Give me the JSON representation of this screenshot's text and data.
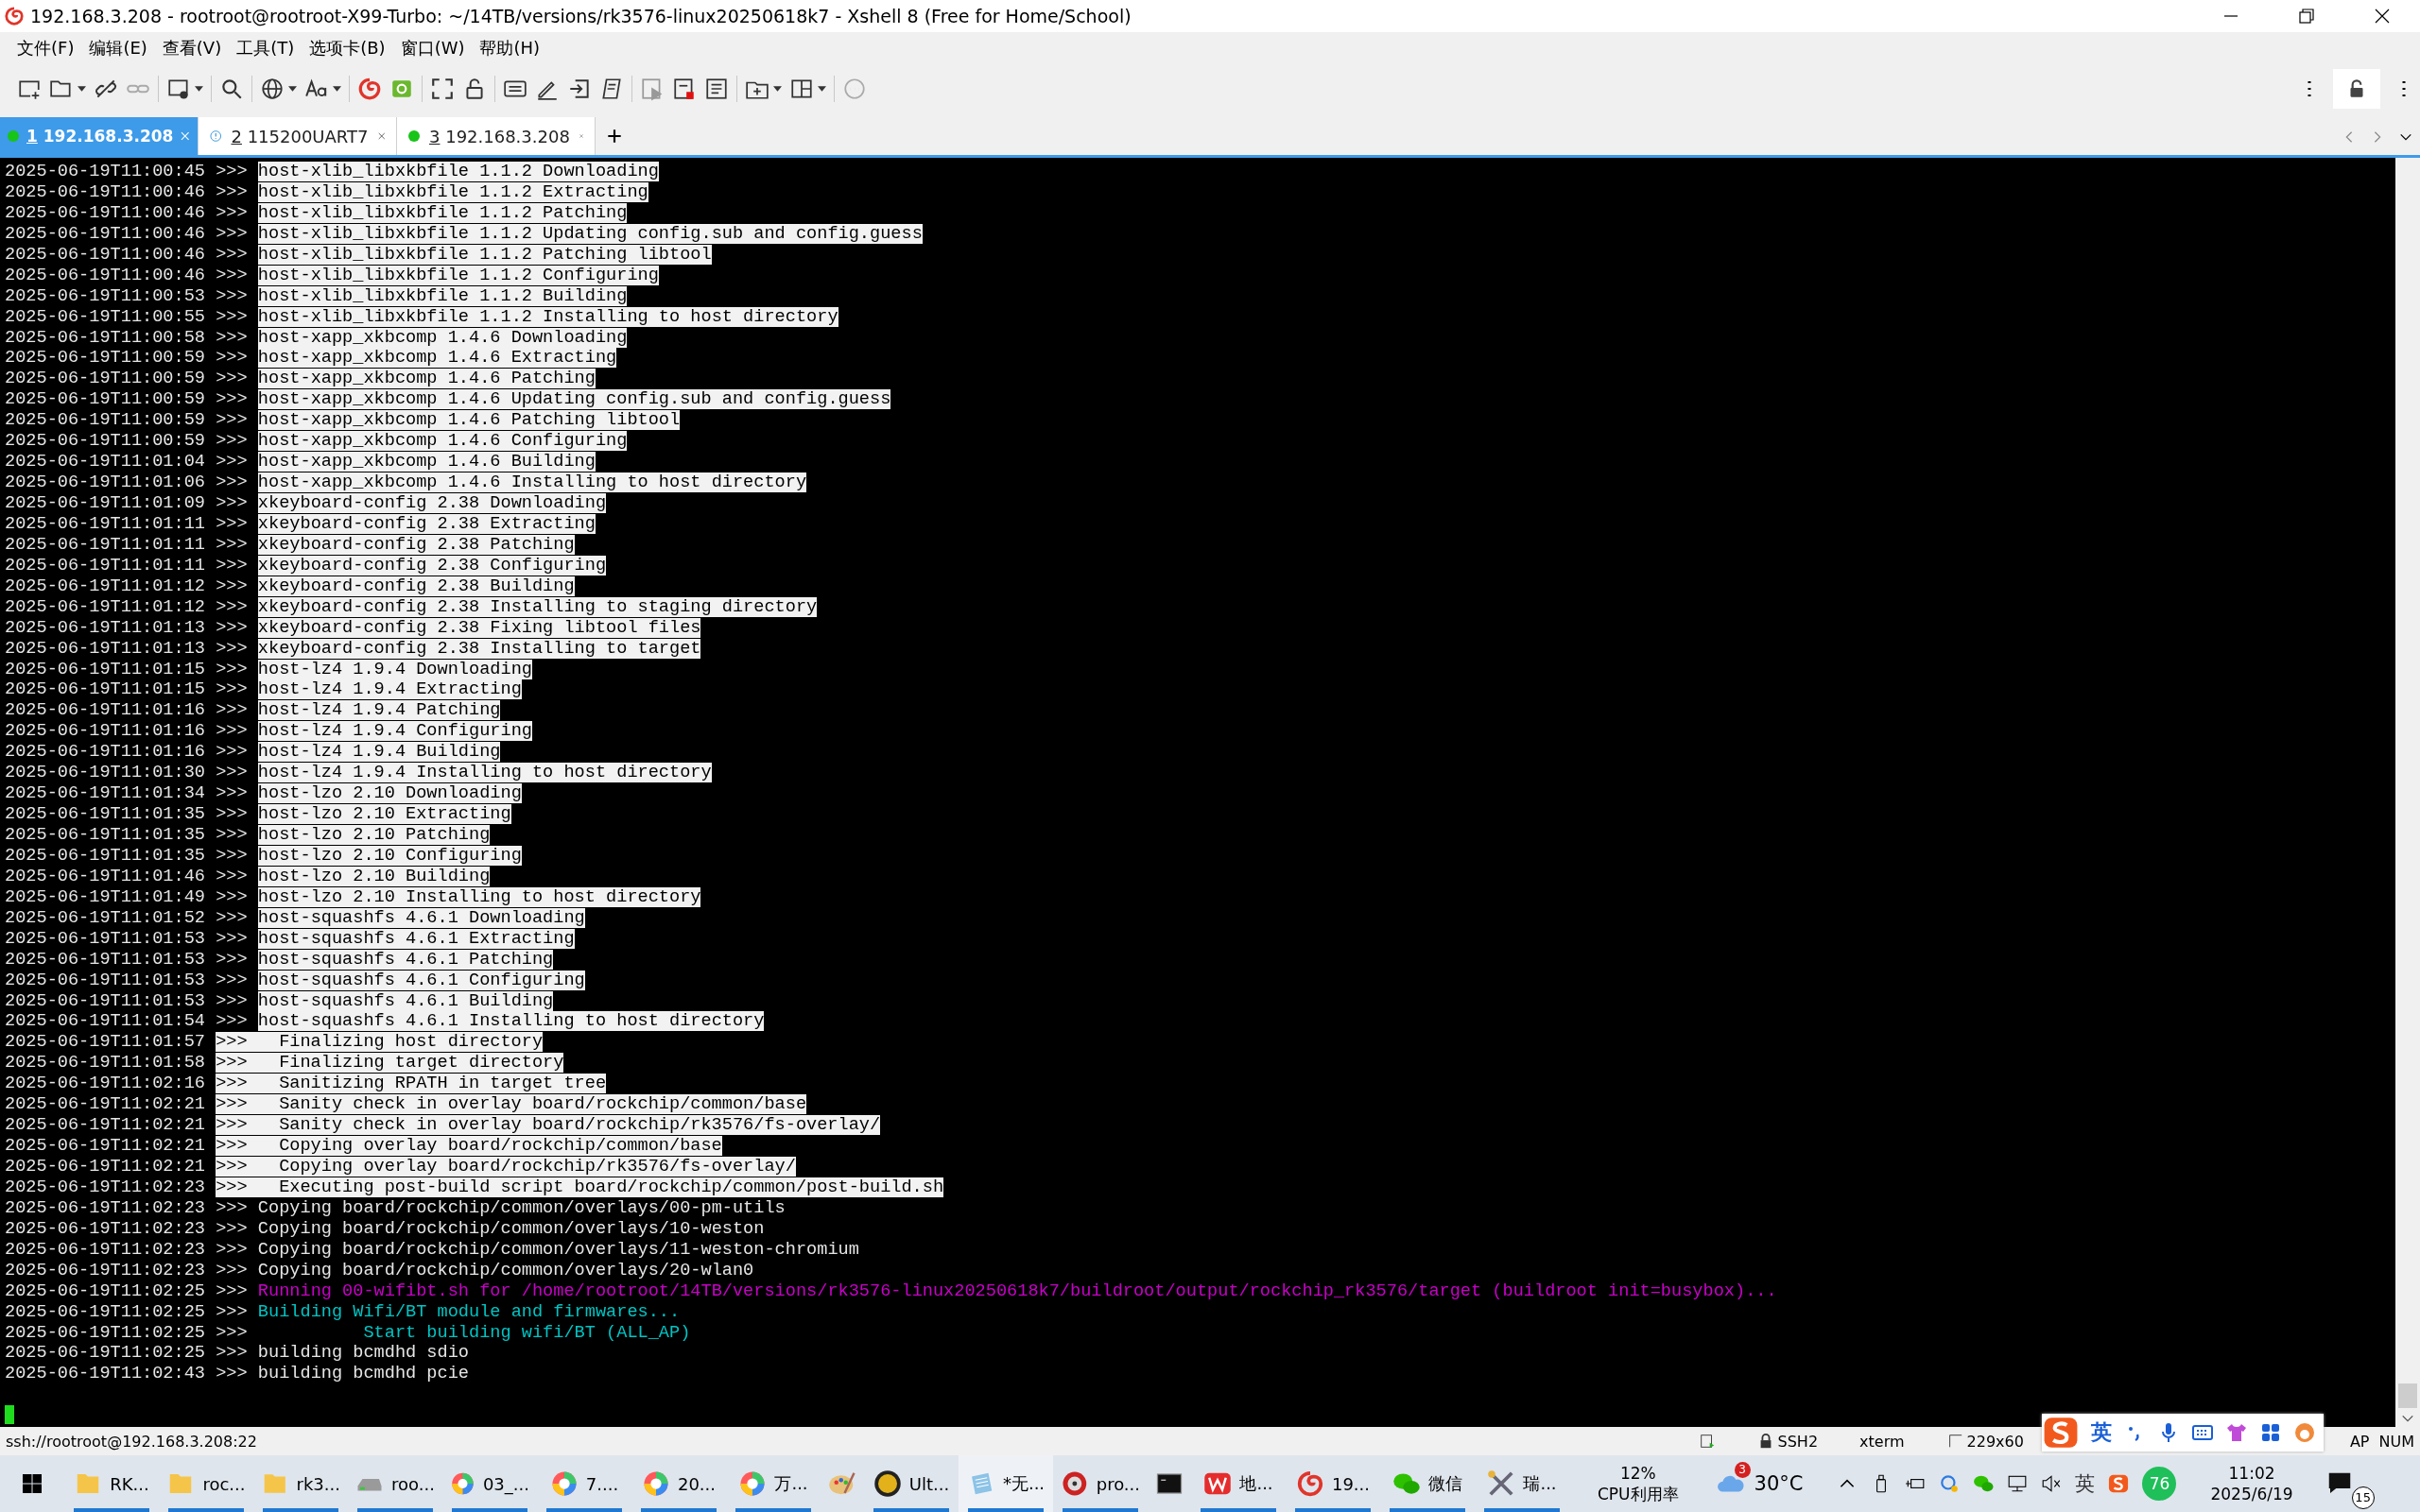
{
  "window": {
    "title": "192.168.3.208 - rootroot@rootroot-X99-Turbo: ~/14TB/versions/rk3576-linux20250618k7 - Xshell 8 (Free for Home/School)"
  },
  "menu": [
    "文件(F)",
    "编辑(E)",
    "查看(V)",
    "工具(T)",
    "选项卡(B)",
    "窗口(W)",
    "帮助(H)"
  ],
  "tabs": [
    {
      "number": "1",
      "label": "192.168.3.208",
      "kind": "connected",
      "selected": true
    },
    {
      "number": "2",
      "label": "115200UART7",
      "kind": "warning",
      "selected": false
    },
    {
      "number": "3",
      "label": "192.168.3.208",
      "kind": "connected",
      "selected": false
    }
  ],
  "terminal": {
    "lines": [
      {
        "time": "2025-06-19T11:00:45",
        "prefix": ">>> ",
        "text": "host-xlib_libxkbfile 1.1.2 Downloading",
        "kind": "inverse"
      },
      {
        "time": "2025-06-19T11:00:46",
        "prefix": ">>> ",
        "text": "host-xlib_libxkbfile 1.1.2 Extracting",
        "kind": "inverse"
      },
      {
        "time": "2025-06-19T11:00:46",
        "prefix": ">>> ",
        "text": "host-xlib_libxkbfile 1.1.2 Patching",
        "kind": "inverse"
      },
      {
        "time": "2025-06-19T11:00:46",
        "prefix": ">>> ",
        "text": "host-xlib_libxkbfile 1.1.2 Updating config.sub and config.guess",
        "kind": "inverse"
      },
      {
        "time": "2025-06-19T11:00:46",
        "prefix": ">>> ",
        "text": "host-xlib_libxkbfile 1.1.2 Patching libtool",
        "kind": "inverse"
      },
      {
        "time": "2025-06-19T11:00:46",
        "prefix": ">>> ",
        "text": "host-xlib_libxkbfile 1.1.2 Configuring",
        "kind": "inverse"
      },
      {
        "time": "2025-06-19T11:00:53",
        "prefix": ">>> ",
        "text": "host-xlib_libxkbfile 1.1.2 Building",
        "kind": "inverse"
      },
      {
        "time": "2025-06-19T11:00:55",
        "prefix": ">>> ",
        "text": "host-xlib_libxkbfile 1.1.2 Installing to host directory",
        "kind": "inverse"
      },
      {
        "time": "2025-06-19T11:00:58",
        "prefix": ">>> ",
        "text": "host-xapp_xkbcomp 1.4.6 Downloading",
        "kind": "inverse"
      },
      {
        "time": "2025-06-19T11:00:59",
        "prefix": ">>> ",
        "text": "host-xapp_xkbcomp 1.4.6 Extracting",
        "kind": "inverse"
      },
      {
        "time": "2025-06-19T11:00:59",
        "prefix": ">>> ",
        "text": "host-xapp_xkbcomp 1.4.6 Patching",
        "kind": "inverse"
      },
      {
        "time": "2025-06-19T11:00:59",
        "prefix": ">>> ",
        "text": "host-xapp_xkbcomp 1.4.6 Updating config.sub and config.guess",
        "kind": "inverse"
      },
      {
        "time": "2025-06-19T11:00:59",
        "prefix": ">>> ",
        "text": "host-xapp_xkbcomp 1.4.6 Patching libtool",
        "kind": "inverse"
      },
      {
        "time": "2025-06-19T11:00:59",
        "prefix": ">>> ",
        "text": "host-xapp_xkbcomp 1.4.6 Configuring",
        "kind": "inverse"
      },
      {
        "time": "2025-06-19T11:01:04",
        "prefix": ">>> ",
        "text": "host-xapp_xkbcomp 1.4.6 Building",
        "kind": "inverse"
      },
      {
        "time": "2025-06-19T11:01:06",
        "prefix": ">>> ",
        "text": "host-xapp_xkbcomp 1.4.6 Installing to host directory",
        "kind": "inverse"
      },
      {
        "time": "2025-06-19T11:01:09",
        "prefix": ">>> ",
        "text": "xkeyboard-config 2.38 Downloading",
        "kind": "inverse"
      },
      {
        "time": "2025-06-19T11:01:11",
        "prefix": ">>> ",
        "text": "xkeyboard-config 2.38 Extracting",
        "kind": "inverse"
      },
      {
        "time": "2025-06-19T11:01:11",
        "prefix": ">>> ",
        "text": "xkeyboard-config 2.38 Patching",
        "kind": "inverse"
      },
      {
        "time": "2025-06-19T11:01:11",
        "prefix": ">>> ",
        "text": "xkeyboard-config 2.38 Configuring",
        "kind": "inverse"
      },
      {
        "time": "2025-06-19T11:01:12",
        "prefix": ">>> ",
        "text": "xkeyboard-config 2.38 Building",
        "kind": "inverse"
      },
      {
        "time": "2025-06-19T11:01:12",
        "prefix": ">>> ",
        "text": "xkeyboard-config 2.38 Installing to staging directory",
        "kind": "inverse"
      },
      {
        "time": "2025-06-19T11:01:13",
        "prefix": ">>> ",
        "text": "xkeyboard-config 2.38 Fixing libtool files",
        "kind": "inverse"
      },
      {
        "time": "2025-06-19T11:01:13",
        "prefix": ">>> ",
        "text": "xkeyboard-config 2.38 Installing to target",
        "kind": "inverse"
      },
      {
        "time": "2025-06-19T11:01:15",
        "prefix": ">>> ",
        "text": "host-lz4 1.9.4 Downloading",
        "kind": "inverse"
      },
      {
        "time": "2025-06-19T11:01:15",
        "prefix": ">>> ",
        "text": "host-lz4 1.9.4 Extracting",
        "kind": "inverse"
      },
      {
        "time": "2025-06-19T11:01:16",
        "prefix": ">>> ",
        "text": "host-lz4 1.9.4 Patching",
        "kind": "inverse"
      },
      {
        "time": "2025-06-19T11:01:16",
        "prefix": ">>> ",
        "text": "host-lz4 1.9.4 Configuring",
        "kind": "inverse"
      },
      {
        "time": "2025-06-19T11:01:16",
        "prefix": ">>> ",
        "text": "host-lz4 1.9.4 Building",
        "kind": "inverse"
      },
      {
        "time": "2025-06-19T11:01:30",
        "prefix": ">>> ",
        "text": "host-lz4 1.9.4 Installing to host directory",
        "kind": "inverse"
      },
      {
        "time": "2025-06-19T11:01:34",
        "prefix": ">>> ",
        "text": "host-lzo 2.10 Downloading",
        "kind": "inverse"
      },
      {
        "time": "2025-06-19T11:01:35",
        "prefix": ">>> ",
        "text": "host-lzo 2.10 Extracting",
        "kind": "inverse"
      },
      {
        "time": "2025-06-19T11:01:35",
        "prefix": ">>> ",
        "text": "host-lzo 2.10 Patching",
        "kind": "inverse"
      },
      {
        "time": "2025-06-19T11:01:35",
        "prefix": ">>> ",
        "text": "host-lzo 2.10 Configuring",
        "kind": "inverse"
      },
      {
        "time": "2025-06-19T11:01:46",
        "prefix": ">>> ",
        "text": "host-lzo 2.10 Building",
        "kind": "inverse"
      },
      {
        "time": "2025-06-19T11:01:49",
        "prefix": ">>> ",
        "text": "host-lzo 2.10 Installing to host directory",
        "kind": "inverse"
      },
      {
        "time": "2025-06-19T11:01:52",
        "prefix": ">>> ",
        "text": "host-squashfs 4.6.1 Downloading",
        "kind": "inverse"
      },
      {
        "time": "2025-06-19T11:01:53",
        "prefix": ">>> ",
        "text": "host-squashfs 4.6.1 Extracting",
        "kind": "inverse"
      },
      {
        "time": "2025-06-19T11:01:53",
        "prefix": ">>> ",
        "text": "host-squashfs 4.6.1 Patching",
        "kind": "inverse"
      },
      {
        "time": "2025-06-19T11:01:53",
        "prefix": ">>> ",
        "text": "host-squashfs 4.6.1 Configuring",
        "kind": "inverse"
      },
      {
        "time": "2025-06-19T11:01:53",
        "prefix": ">>> ",
        "text": "host-squashfs 4.6.1 Building",
        "kind": "inverse"
      },
      {
        "time": "2025-06-19T11:01:54",
        "prefix": ">>> ",
        "text": "host-squashfs 4.6.1 Installing to host directory",
        "kind": "inverse"
      },
      {
        "time": "2025-06-19T11:01:57",
        "text": ">>>   Finalizing host directory",
        "kind": "inverse"
      },
      {
        "time": "2025-06-19T11:01:58",
        "text": ">>>   Finalizing target directory",
        "kind": "inverse"
      },
      {
        "time": "2025-06-19T11:02:16",
        "text": ">>>   Sanitizing RPATH in target tree",
        "kind": "inverse"
      },
      {
        "time": "2025-06-19T11:02:21",
        "text": ">>>   Sanity check in overlay board/rockchip/common/base",
        "kind": "inverse"
      },
      {
        "time": "2025-06-19T11:02:21",
        "text": ">>>   Sanity check in overlay board/rockchip/rk3576/fs-overlay/",
        "kind": "inverse"
      },
      {
        "time": "2025-06-19T11:02:21",
        "text": ">>>   Copying overlay board/rockchip/common/base",
        "kind": "inverse"
      },
      {
        "time": "2025-06-19T11:02:21",
        "text": ">>>   Copying overlay board/rockchip/rk3576/fs-overlay/",
        "kind": "inverse"
      },
      {
        "time": "2025-06-19T11:02:23",
        "text": ">>>   Executing post-build script board/rockchip/common/post-build.sh",
        "kind": "inverse"
      },
      {
        "time": "2025-06-19T11:02:23",
        "prefix": ">>> ",
        "text": "Copying board/rockchip/common/overlays/00-pm-utils",
        "kind": "plain"
      },
      {
        "time": "2025-06-19T11:02:23",
        "prefix": ">>> ",
        "text": "Copying board/rockchip/common/overlays/10-weston",
        "kind": "plain"
      },
      {
        "time": "2025-06-19T11:02:23",
        "prefix": ">>> ",
        "text": "Copying board/rockchip/common/overlays/11-weston-chromium",
        "kind": "plain"
      },
      {
        "time": "2025-06-19T11:02:23",
        "prefix": ">>> ",
        "text": "Copying board/rockchip/common/overlays/20-wlan0",
        "kind": "plain"
      },
      {
        "time": "2025-06-19T11:02:25",
        "prefix": ">>> ",
        "text": "Running 00-wifibt.sh for /home/rootroot/14TB/versions/rk3576-linux20250618k7/buildroot/output/rockchip_rk3576/target (buildroot init=busybox)...",
        "kind": "magenta"
      },
      {
        "time": "2025-06-19T11:02:25",
        "prefix": ">>> ",
        "text": "Building Wifi/BT module and firmwares...",
        "kind": "cyan"
      },
      {
        "time": "2025-06-19T11:02:25",
        "prefix": ">>> ",
        "text": "          Start building wifi/BT (ALL_AP)",
        "kind": "cyan"
      },
      {
        "time": "2025-06-19T11:02:25",
        "prefix": ">>> ",
        "text": "building bcmdhd sdio",
        "kind": "plain"
      },
      {
        "time": "2025-06-19T11:02:43",
        "prefix": ">>> ",
        "text": "building bcmdhd pcie",
        "kind": "plain"
      }
    ]
  },
  "status_bar": {
    "address": "ssh://rootroot@192.168.3.208:22",
    "protocol": "SSH2",
    "terminal_type": "xterm",
    "size": "229x60",
    "caps": "AP",
    "num": "NUM"
  },
  "ime_bar": {
    "language": "英"
  },
  "taskbar": {
    "apps": [
      {
        "kind": "folder",
        "label": "RK...",
        "running": true,
        "selected": false
      },
      {
        "kind": "folder",
        "label": "roc...",
        "running": true,
        "selected": false
      },
      {
        "kind": "folder",
        "label": "rk3...",
        "running": true,
        "selected": false
      },
      {
        "kind": "drive",
        "label": "roo...",
        "running": true,
        "selected": false
      },
      {
        "kind": "swirl",
        "label": "03_...",
        "running": true,
        "selected": false
      },
      {
        "kind": "swirl",
        "label": "7....",
        "running": true,
        "selected": false
      },
      {
        "kind": "swirl",
        "label": "20...",
        "running": true,
        "selected": false
      },
      {
        "kind": "swirl",
        "label": "万...",
        "running": true,
        "selected": false
      },
      {
        "kind": "palette",
        "running": false,
        "selected": false
      },
      {
        "kind": "ue",
        "label": "Ult...",
        "running": true,
        "selected": false
      },
      {
        "kind": "notepad",
        "label": "*无...",
        "running": true,
        "selected": true
      },
      {
        "kind": "disc",
        "label": "pro...",
        "running": true,
        "selected": false
      },
      {
        "kind": "console",
        "running": false,
        "selected": false
      },
      {
        "kind": "wps",
        "label": "地...",
        "running": true,
        "selected": false
      },
      {
        "kind": "shell",
        "label": "19...",
        "running": true,
        "selected": false
      },
      {
        "kind": "chat",
        "label": "微信",
        "running": true,
        "selected": false
      },
      {
        "kind": "tools",
        "label": "瑞...",
        "running": true,
        "selected": false
      }
    ],
    "cpu": {
      "value": "12%",
      "label": "CPU利用率"
    },
    "weather": {
      "badge": "3",
      "temperature": "30°C"
    },
    "tray": {
      "ime": "英",
      "security_badge": "76"
    },
    "clock": {
      "time": "11:02",
      "date": "2025/6/19"
    },
    "notifications": "15"
  }
}
